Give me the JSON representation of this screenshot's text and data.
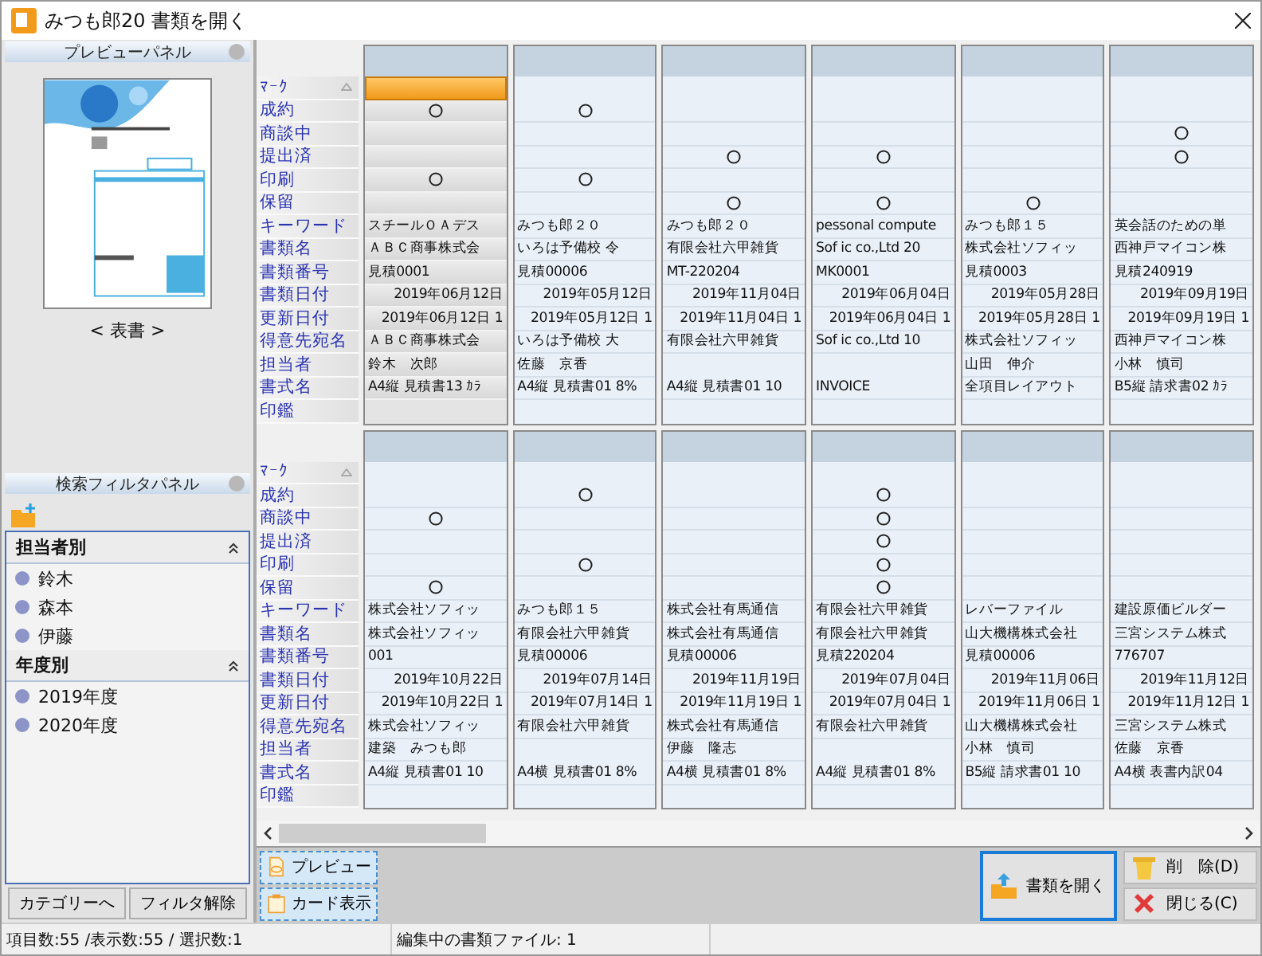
{
  "window": {
    "title": "みつも郎20 書類を開く"
  },
  "preview_panel": {
    "title": "プレビューパネル",
    "caption": "< 表書 >"
  },
  "filter_panel": {
    "title": "検索フィルタパネル",
    "groups": [
      {
        "label": "担当者別",
        "expanded": true,
        "items": [
          "鈴木",
          "森本",
          "伊藤"
        ]
      },
      {
        "label": "年度別",
        "expanded": true,
        "items": [
          "2019年度",
          "2020年度"
        ]
      }
    ]
  },
  "left_buttons": [
    "カテゴリーへ",
    "フィルタ解除"
  ],
  "card_rows": [
    {
      "labels": [
        "ﾏｰｸ",
        "成約",
        "商談中",
        "提出済",
        "印刷",
        "保留",
        "キーワード",
        "書類名",
        "書類番号",
        "書類日付",
        "更新日付",
        "得意先宛名",
        "担当者",
        "書式名",
        "印鑑"
      ],
      "cards": [
        {
          "selected": true,
          "flags": [
            true,
            false,
            false,
            true,
            false
          ],
          "keyword": "スチールＯＡデス",
          "doc_name": "ＡＢＣ商事株式会",
          "doc_number": "見積0001",
          "doc_date": "2019年06月12日",
          "updated": "2019年06月12日 1",
          "client": "ＡＢＣ商事株式会",
          "person": "鈴木　次郎",
          "format": "A4縦 見積書13 ｶﾗ"
        },
        {
          "selected": false,
          "flags": [
            true,
            false,
            false,
            true,
            false
          ],
          "keyword": "みつも郎２０",
          "doc_name": "いろは予備校 令",
          "doc_number": "見積00006",
          "doc_date": "2019年05月12日",
          "updated": "2019年05月12日 1",
          "client": "いろは予備校 大",
          "person": "佐藤　京香",
          "format": "A4縦 見積書01 8%"
        },
        {
          "selected": false,
          "flags": [
            false,
            false,
            true,
            false,
            true
          ],
          "keyword": "みつも郎２０",
          "doc_name": "有限会社六甲雑貨",
          "doc_number": "MT-220204",
          "doc_date": "2019年11月04日",
          "updated": "2019年11月04日 1",
          "client": "有限会社六甲雑貨",
          "format": "A4縦 見積書01 10"
        },
        {
          "selected": false,
          "flags": [
            false,
            false,
            true,
            false,
            true
          ],
          "keyword": "pessonal compute",
          "doc_name": "Sof ic co.,Ltd 20",
          "doc_number": "MK0001",
          "doc_date": "2019年06月04日",
          "updated": "2019年06月04日 1",
          "client": "Sof ic co.,Ltd 10",
          "format": "INVOICE"
        },
        {
          "selected": false,
          "flags": [
            false,
            false,
            false,
            false,
            true
          ],
          "keyword": "みつも郎１５",
          "doc_name": "株式会社ソフィッ",
          "doc_number": "見積0003",
          "doc_date": "2019年05月28日",
          "updated": "2019年05月28日 1",
          "client": "株式会社ソフィッ",
          "person": "山田　伸介",
          "format": "全項目レイアウト"
        },
        {
          "selected": false,
          "flags": [
            false,
            true,
            true,
            false,
            false
          ],
          "keyword": "英会話のための単",
          "doc_name": "西神戸マイコン株",
          "doc_number": "見積240919",
          "doc_date": "2019年09月19日",
          "updated": "2019年09月19日 1",
          "client": "西神戸マイコン株",
          "person": "小林　慎司",
          "format": "B5縦 請求書02 ｶﾗ"
        }
      ]
    },
    {
      "labels": [
        "ﾏｰｸ",
        "成約",
        "商談中",
        "提出済",
        "印刷",
        "保留",
        "キーワード",
        "書類名",
        "書類番号",
        "書類日付",
        "更新日付",
        "得意先宛名",
        "担当者",
        "書式名",
        "印鑑"
      ],
      "cards": [
        {
          "selected": false,
          "flags": [
            false,
            true,
            false,
            false,
            true
          ],
          "keyword": "株式会社ソフィッ",
          "doc_name": "株式会社ソフィッ",
          "doc_number": "001",
          "doc_date": "2019年10月22日",
          "updated": "2019年10月22日 1",
          "client": "株式会社ソフィッ",
          "person": "建築　みつも郎",
          "format": "A4縦 見積書01 10"
        },
        {
          "selected": false,
          "flags": [
            true,
            false,
            false,
            true,
            false
          ],
          "keyword": "みつも郎１５",
          "doc_name": "有限会社六甲雑貨",
          "doc_number": "見積00006",
          "doc_date": "2019年07月14日",
          "updated": "2019年07月14日 1",
          "client": "有限会社六甲雑貨",
          "format": "A4横 見積書01 8%"
        },
        {
          "selected": false,
          "flags": [
            false,
            false,
            false,
            false,
            false
          ],
          "keyword": "株式会社有馬通信",
          "doc_name": "株式会社有馬通信",
          "doc_number": "見積00006",
          "doc_date": "2019年11月19日",
          "updated": "2019年11月19日 1",
          "client": "株式会社有馬通信",
          "person": "伊藤　隆志",
          "format": "A4横 見積書01 8%"
        },
        {
          "selected": false,
          "flags": [
            true,
            true,
            true,
            true,
            true
          ],
          "keyword": "有限会社六甲雑貨",
          "doc_name": "有限会社六甲雑貨",
          "doc_number": "見積220204",
          "doc_date": "2019年07月04日",
          "updated": "2019年07月04日 1",
          "client": "有限会社六甲雑貨",
          "format": "A4縦 見積書01 8%"
        },
        {
          "selected": false,
          "flags": [
            false,
            false,
            false,
            false,
            false
          ],
          "keyword": "レバーファイル",
          "doc_name": "山大機構株式会社",
          "doc_number": "見積00006",
          "doc_date": "2019年11月06日",
          "updated": "2019年11月06日 1",
          "client": "山大機構株式会社",
          "person": "小林　慎司",
          "format": "B5縦 請求書01 10"
        },
        {
          "selected": false,
          "flags": [
            false,
            false,
            false,
            false,
            false
          ],
          "keyword": "建設原価ビルダー",
          "doc_name": "三宮システム株式",
          "doc_number": "776707",
          "doc_date": "2019年11月12日",
          "updated": "2019年11月12日 1",
          "client": "三宮システム株式",
          "person": "佐藤　京香",
          "format": "A4横 表書内訳04"
        }
      ]
    }
  ],
  "view_buttons": [
    {
      "label": "プレビュー",
      "kind": "preview"
    },
    {
      "label": "カード表示",
      "kind": "card"
    }
  ],
  "actions": [
    {
      "label": "書類を開く",
      "kind": "open"
    },
    {
      "label": "削　除(D)",
      "kind": "delete"
    },
    {
      "label": "閉じる(C)",
      "kind": "close"
    }
  ],
  "status_bar": [
    "項目数:55 /表示数:55 / 選択数:1",
    "編集中の書類ファイル: 1"
  ]
}
